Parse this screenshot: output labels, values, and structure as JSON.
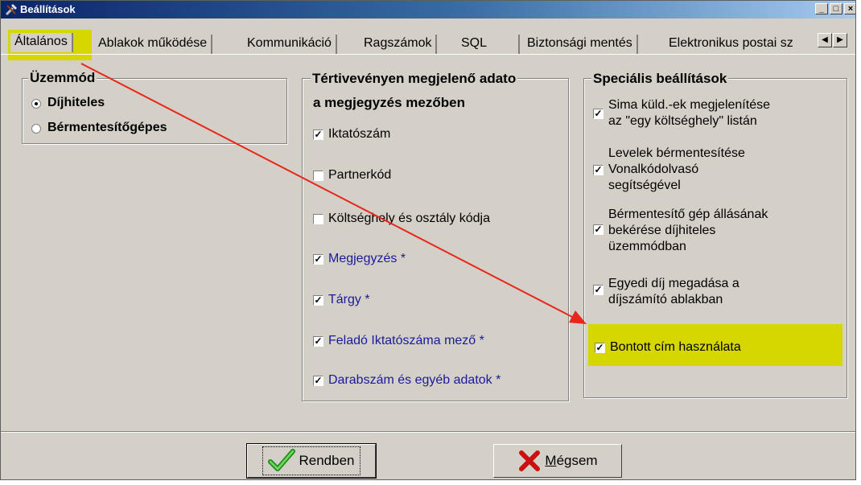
{
  "window": {
    "title": "Beállítások"
  },
  "tabs": [
    "Általános",
    "Ablakok működése",
    "Kommunikáció",
    "Ragszámok",
    "SQL",
    "Biztonsági mentés",
    "Elektronikus postai sz"
  ],
  "mode_group": {
    "title": "Üzemmód",
    "options": [
      {
        "label": "Díjhiteles",
        "selected": true
      },
      {
        "label": "Bérmentesítőgépes",
        "selected": false
      }
    ]
  },
  "receipt_group": {
    "title_line1": "Tértivevényen megjelenő adato",
    "title_line2": "a megjegyzés mezőben",
    "items": [
      {
        "label": "Iktatószám",
        "checked": true
      },
      {
        "label": "Partnerkód",
        "checked": false
      },
      {
        "label": "Költséghely és osztály kódja",
        "checked": false
      },
      {
        "label": "Megjegyzés *",
        "checked": true
      },
      {
        "label": "Tárgy *",
        "checked": true
      },
      {
        "label": "Feladó Iktatószáma mező *",
        "checked": true
      },
      {
        "label": "Darabszám és egyéb adatok *",
        "checked": true
      }
    ]
  },
  "special_group": {
    "title": "Speciális beállítások",
    "items": [
      {
        "line1": "Sima küld.-ek megjelenítése",
        "line2": "az \"egy költséghely\" listán",
        "line3": "",
        "checked": true
      },
      {
        "line1": "Levelek bérmentesítése",
        "line2": "Vonalkódolvasó",
        "line3": "segítségével",
        "checked": true
      },
      {
        "line1": "Bérmentesítő gép állásának",
        "line2": "bekérése díjhiteles",
        "line3": "üzemmódban",
        "checked": true
      },
      {
        "line1": "Egyedi díj megadása a",
        "line2": "díjszámító ablakban",
        "line3": "",
        "checked": true
      },
      {
        "line1": "Bontott cím használata",
        "line2": "",
        "line3": "",
        "checked": true
      }
    ]
  },
  "buttons": {
    "ok": "Rendben",
    "cancel_prefix": "M",
    "cancel_rest": "égsem"
  },
  "colors": {
    "highlight": "#d6d600",
    "annotation_arrow": "#e8261c",
    "blue_text": "#1a1a9a"
  }
}
